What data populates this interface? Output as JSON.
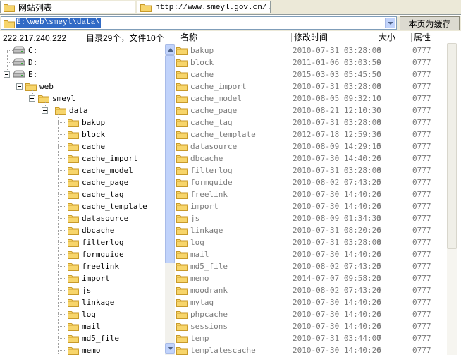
{
  "tabs": [
    {
      "label": "网站列表"
    },
    {
      "label": "http://www.smeyl.gov.cn/..."
    }
  ],
  "pathbar": {
    "path": "E:\\web\\smeyl\\data\\",
    "save_button": "本页为缓存"
  },
  "info": {
    "ip": "222.217.240.222",
    "summary": "目录29个，文件10个"
  },
  "columns": {
    "name": "名称",
    "time": "修改时间",
    "size": "大小",
    "attr": "属性"
  },
  "tree": {
    "drives": [
      "C:",
      "D:",
      "E:"
    ],
    "web": "web",
    "site": "smeyl",
    "data": "data",
    "children": [
      "bakup",
      "block",
      "cache",
      "cache_import",
      "cache_model",
      "cache_page",
      "cache_tag",
      "cache_template",
      "datasource",
      "dbcache",
      "filterlog",
      "formguide",
      "freelink",
      "import",
      "js",
      "linkage",
      "log",
      "mail",
      "md5_file",
      "memo"
    ]
  },
  "files": [
    {
      "name": "bakup",
      "time": "2010-07-31 03:28:08",
      "size": "0",
      "attr": "0777"
    },
    {
      "name": "block",
      "time": "2011-01-06 03:03:59",
      "size": "0",
      "attr": "0777"
    },
    {
      "name": "cache",
      "time": "2015-03-03 05:45:50",
      "size": "0",
      "attr": "0777"
    },
    {
      "name": "cache_import",
      "time": "2010-07-31 03:28:08",
      "size": "0",
      "attr": "0777"
    },
    {
      "name": "cache_model",
      "time": "2010-08-05 09:32:10",
      "size": "0",
      "attr": "0777"
    },
    {
      "name": "cache_page",
      "time": "2010-08-21 12:10:30",
      "size": "0",
      "attr": "0777"
    },
    {
      "name": "cache_tag",
      "time": "2010-07-31 03:28:08",
      "size": "0",
      "attr": "0777"
    },
    {
      "name": "cache_template",
      "time": "2012-07-18 12:59:36",
      "size": "0",
      "attr": "0777"
    },
    {
      "name": "datasource",
      "time": "2010-08-09 14:29:15",
      "size": "0",
      "attr": "0777"
    },
    {
      "name": "dbcache",
      "time": "2010-07-30 14:40:26",
      "size": "0",
      "attr": "0777"
    },
    {
      "name": "filterlog",
      "time": "2010-07-31 03:28:08",
      "size": "0",
      "attr": "0777"
    },
    {
      "name": "formguide",
      "time": "2010-08-02 07:43:25",
      "size": "0",
      "attr": "0777"
    },
    {
      "name": "freelink",
      "time": "2010-07-30 14:40:26",
      "size": "0",
      "attr": "0777"
    },
    {
      "name": "import",
      "time": "2010-07-30 14:40:26",
      "size": "0",
      "attr": "0777"
    },
    {
      "name": "js",
      "time": "2010-08-09 01:34:33",
      "size": "0",
      "attr": "0777"
    },
    {
      "name": "linkage",
      "time": "2010-07-31 08:20:26",
      "size": "0",
      "attr": "0777"
    },
    {
      "name": "log",
      "time": "2010-07-31 03:28:08",
      "size": "0",
      "attr": "0777"
    },
    {
      "name": "mail",
      "time": "2010-07-30 14:40:26",
      "size": "0",
      "attr": "0777"
    },
    {
      "name": "md5_file",
      "time": "2010-08-02 07:43:25",
      "size": "0",
      "attr": "0777"
    },
    {
      "name": "memo",
      "time": "2014-07-07 09:58:23",
      "size": "0",
      "attr": "0777"
    },
    {
      "name": "moodrank",
      "time": "2010-08-02 07:43:24",
      "size": "0",
      "attr": "0777"
    },
    {
      "name": "mytag",
      "time": "2010-07-30 14:40:26",
      "size": "0",
      "attr": "0777"
    },
    {
      "name": "phpcache",
      "time": "2010-07-30 14:40:26",
      "size": "0",
      "attr": "0777"
    },
    {
      "name": "sessions",
      "time": "2010-07-30 14:40:26",
      "size": "0",
      "attr": "0777"
    },
    {
      "name": "temp",
      "time": "2010-07-31 03:44:07",
      "size": "0",
      "attr": "0777"
    },
    {
      "name": "templatescache",
      "time": "2010-07-30 14:40:26",
      "size": "0",
      "attr": "0777"
    }
  ],
  "colors": {
    "folder": "#f7d56b",
    "folder_edge": "#c89a2a",
    "selection": "#316ac5",
    "scroll": "#c1d3fb",
    "muted_text": "#7a7a7a"
  }
}
